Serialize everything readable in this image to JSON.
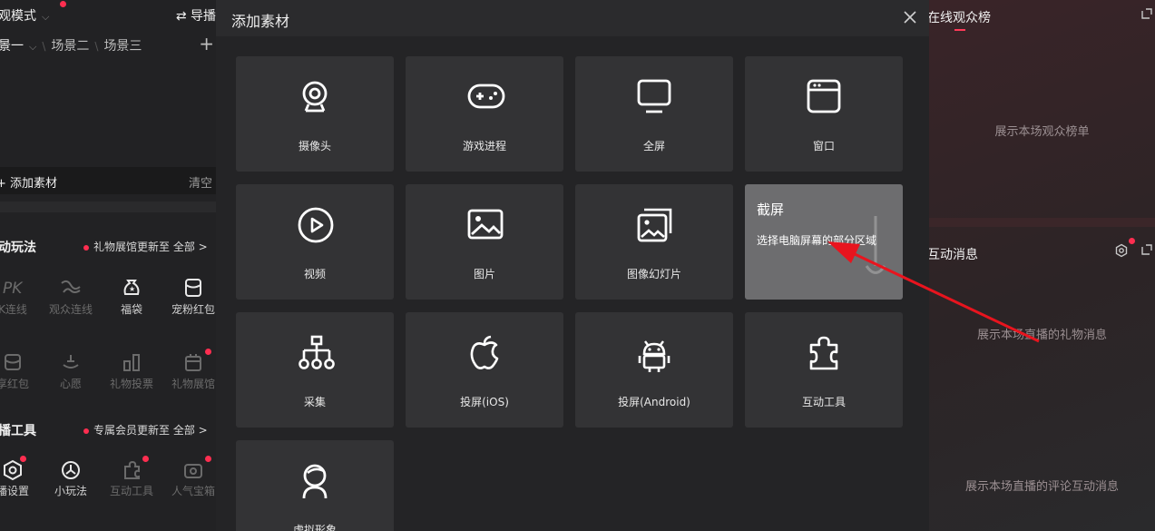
{
  "left_panel": {
    "mode_label": "观模式",
    "guide_label": "⇄ 导播",
    "scenes": [
      "景一",
      "场景二",
      "场景三"
    ],
    "add_plus": "+",
    "add_material_label": "+ 添加素材",
    "clear_label": "清空",
    "interactive": {
      "title": "动玩法",
      "note": "礼物展馆更新至 全部 >",
      "row1": [
        {
          "label": "K连线",
          "icon": "pk-icon",
          "dim": true
        },
        {
          "label": "观众连线",
          "icon": "audience-link-icon",
          "dim": true
        },
        {
          "label": "福袋",
          "icon": "lucky-bag-icon",
          "dim": false
        },
        {
          "label": "宠粉红包",
          "icon": "red-packet-icon",
          "dim": false
        }
      ],
      "row2": [
        {
          "label": "享红包",
          "icon": "share-packet-icon",
          "dim": true
        },
        {
          "label": "心愿",
          "icon": "wish-icon",
          "dim": true
        },
        {
          "label": "礼物投票",
          "icon": "gift-vote-icon",
          "dim": true
        },
        {
          "label": "礼物展馆",
          "icon": "gift-hall-icon",
          "dim": true
        }
      ]
    },
    "tools": {
      "title": "播工具",
      "note": "专属会员更新至 全部 >",
      "row": [
        {
          "label": "播设置",
          "icon": "settings-icon",
          "dim": false
        },
        {
          "label": "小玩法",
          "icon": "mini-game-icon",
          "dim": false
        },
        {
          "label": "互动工具",
          "icon": "puzzle-icon",
          "dim": true
        },
        {
          "label": "人气宝箱",
          "icon": "treasure-icon",
          "dim": true
        }
      ]
    }
  },
  "modal": {
    "title": "添加素材",
    "close_icon": "close-icon",
    "tiles": [
      {
        "label": "摄像头",
        "icon": "camera-icon"
      },
      {
        "label": "游戏进程",
        "icon": "gamepad-icon"
      },
      {
        "label": "全屏",
        "icon": "monitor-icon"
      },
      {
        "label": "窗口",
        "icon": "window-icon"
      },
      {
        "label": "视频",
        "icon": "play-icon"
      },
      {
        "label": "图片",
        "icon": "image-icon"
      },
      {
        "label": "图像幻灯片",
        "icon": "slideshow-icon"
      },
      {
        "label": "截屏",
        "icon": "screenshot-icon",
        "description": "选择电脑屏幕的部分区域"
      },
      {
        "label": "采集",
        "icon": "capture-icon"
      },
      {
        "label": "投屏(iOS)",
        "icon": "apple-icon"
      },
      {
        "label": "投屏(Android)",
        "icon": "android-icon"
      },
      {
        "label": "互动工具",
        "icon": "puzzle-icon"
      },
      {
        "label": "虚拟形象",
        "icon": "avatar-icon"
      }
    ]
  },
  "right_panel": {
    "audience_title": "在线观众榜",
    "audience_empty": "展示本场观众榜单",
    "messages_title": "互动消息",
    "gift_empty": "展示本场直播的礼物消息",
    "comment_empty": "展示本场直播的评论互动消息"
  },
  "colors": {
    "accent_red": "#ff2e50",
    "annotation_arrow": "#e8141e",
    "tile_bg": "#333335",
    "tile_highlight": "#6d6d6f"
  }
}
